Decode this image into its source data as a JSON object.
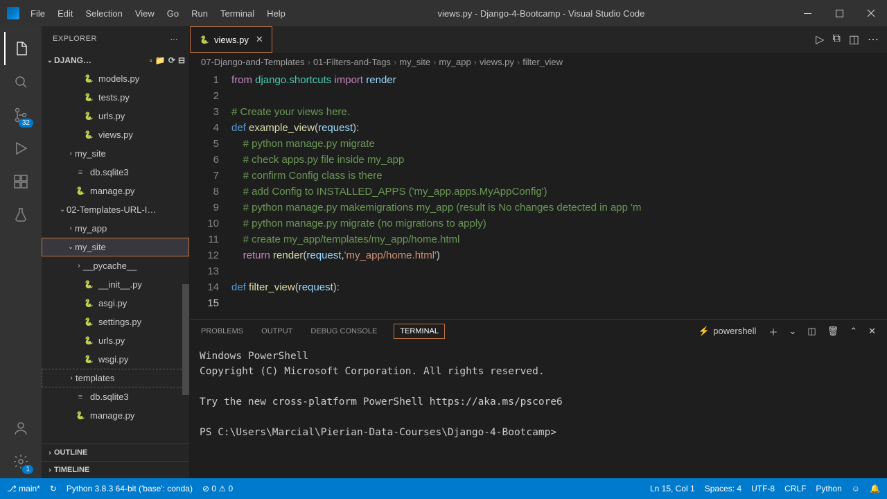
{
  "title": "views.py - Django-4-Bootcamp - Visual Studio Code",
  "menu": [
    "File",
    "Edit",
    "Selection",
    "View",
    "Go",
    "Run",
    "Terminal",
    "Help"
  ],
  "activity_badges": {
    "scm": "32",
    "settings": "1"
  },
  "explorer": {
    "title": "EXPLORER",
    "project": "DJANG…",
    "outline": "OUTLINE",
    "timeline": "TIMELINE",
    "tree": [
      {
        "pad": 36,
        "icon": "py",
        "label": "models.py"
      },
      {
        "pad": 36,
        "icon": "py",
        "label": "tests.py"
      },
      {
        "pad": 36,
        "icon": "py",
        "label": "urls.py"
      },
      {
        "pad": 36,
        "icon": "py",
        "label": "views.py"
      },
      {
        "pad": 24,
        "chev": "›",
        "icon": "",
        "label": "my_site"
      },
      {
        "pad": 24,
        "icon": "db",
        "label": "db.sqlite3"
      },
      {
        "pad": 24,
        "icon": "py",
        "label": "manage.py"
      },
      {
        "pad": 12,
        "chev": "⌄",
        "icon": "",
        "label": "02-Templates-URL-I…"
      },
      {
        "pad": 24,
        "chev": "›",
        "icon": "",
        "label": "my_app"
      },
      {
        "pad": 24,
        "chev": "⌄",
        "icon": "",
        "label": "my_site",
        "selected": true
      },
      {
        "pad": 36,
        "chev": "›",
        "icon": "",
        "label": "__pycache__"
      },
      {
        "pad": 36,
        "icon": "py",
        "label": "__init__.py"
      },
      {
        "pad": 36,
        "icon": "py",
        "label": "asgi.py"
      },
      {
        "pad": 36,
        "icon": "py",
        "label": "settings.py"
      },
      {
        "pad": 36,
        "icon": "py",
        "label": "urls.py"
      },
      {
        "pad": 36,
        "icon": "py",
        "label": "wsgi.py"
      },
      {
        "pad": 24,
        "chev": "›",
        "icon": "",
        "label": "templates",
        "dashed": true
      },
      {
        "pad": 24,
        "icon": "db",
        "label": "db.sqlite3"
      },
      {
        "pad": 24,
        "icon": "py",
        "label": "manage.py"
      }
    ]
  },
  "tab": {
    "label": "views.py"
  },
  "breadcrumb": [
    "07-Django-and-Templates",
    "01-Filters-and-Tags",
    "my_site",
    "my_app",
    "views.py",
    "filter_view"
  ],
  "code_lines": [
    {
      "n": "1",
      "h": "<span class='kw'>from</span> <span class='mod'>django.shortcuts</span> <span class='kw'>import</span> <span class='var'>render</span>"
    },
    {
      "n": "2",
      "h": ""
    },
    {
      "n": "3",
      "h": "<span class='com'># Create your views here.</span>"
    },
    {
      "n": "4",
      "h": "<span class='def'>def</span> <span class='fn'>example_view</span>(<span class='var'>request</span>):"
    },
    {
      "n": "5",
      "h": "    <span class='com'># python manage.py migrate</span>"
    },
    {
      "n": "6",
      "h": "    <span class='com'># check apps.py file inside my_app</span>"
    },
    {
      "n": "7",
      "h": "    <span class='com'># confirm Config class is there</span>"
    },
    {
      "n": "8",
      "h": "    <span class='com'># add Config to INSTALLED_APPS ('my_app.apps.MyAppConfig')</span>"
    },
    {
      "n": "9",
      "h": "    <span class='com'># python manage.py makemigrations my_app (result is No changes detected in app 'm</span>"
    },
    {
      "n": "10",
      "h": "    <span class='com'># python manage.py migrate (no migrations to apply)</span>"
    },
    {
      "n": "11",
      "h": "    <span class='com'># create my_app/templates/my_app/home.html</span>"
    },
    {
      "n": "12",
      "h": "    <span class='kw'>return</span> <span class='fn'>render</span>(<span class='var'>request</span>,<span class='str'>'my_app/home.html'</span>)"
    },
    {
      "n": "13",
      "h": ""
    },
    {
      "n": "14",
      "h": "<span class='def'>def</span> <span class='fn'>filter_view</span>(<span class='var'>request</span>):"
    },
    {
      "n": "15",
      "h": "",
      "cur": true
    }
  ],
  "panel": {
    "tabs": [
      "PROBLEMS",
      "OUTPUT",
      "DEBUG CONSOLE",
      "TERMINAL"
    ],
    "active_tab": 3,
    "shell": "powershell",
    "lines": [
      "Windows PowerShell",
      "Copyright (C) Microsoft Corporation. All rights reserved.",
      "",
      "Try the new cross-platform PowerShell https://aka.ms/pscore6",
      "",
      "PS C:\\Users\\Marcial\\Pierian-Data-Courses\\Django-4-Bootcamp>"
    ]
  },
  "status": {
    "branch": "main*",
    "python": "Python 3.8.3 64-bit ('base': conda)",
    "errors": "0",
    "warnings": "0",
    "ln": "Ln 15, Col 1",
    "spaces": "Spaces: 4",
    "enc": "UTF-8",
    "eol": "CRLF",
    "lang": "Python"
  }
}
